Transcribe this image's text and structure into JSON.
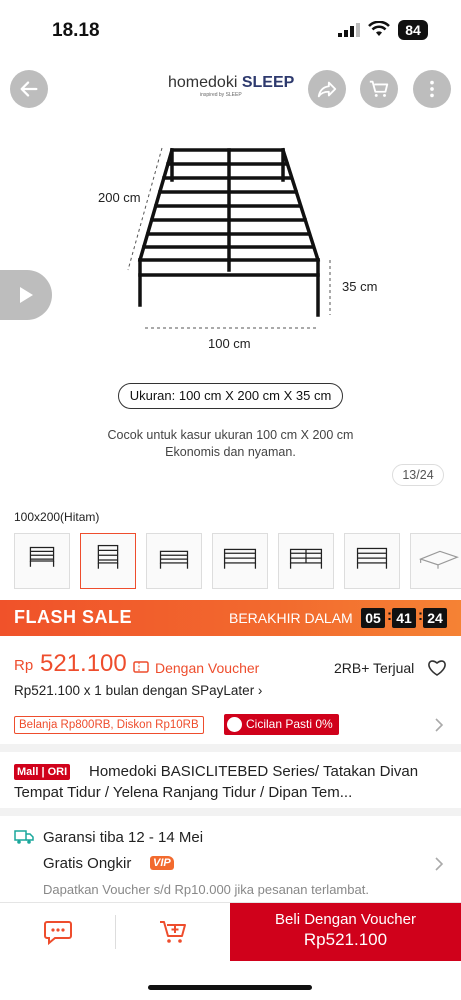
{
  "status_bar": {
    "time": "18.18",
    "battery": "84"
  },
  "header": {
    "brand_name": "homedoki",
    "brand_bold": "SLEEP",
    "brand_sub": "inspired by SLEEP"
  },
  "image": {
    "dim_length": "200 cm",
    "dim_height": "35 cm",
    "dim_width": "100 cm",
    "size_pill": "Ukuran: 100 cm X 200 cm X 35 cm",
    "caption_line1": "Cocok untuk kasur ukuran 100 cm X 200 cm",
    "caption_line2": "Ekonomis dan nyaman.",
    "counter": "13/24"
  },
  "variant": {
    "label": "100x200(Hitam)",
    "thumb_count": 7,
    "selected_index": 1
  },
  "flash_sale": {
    "title": "FLASH SALE",
    "ends_label": "BERAKHIR DALAM",
    "hours": "05",
    "minutes": "41",
    "seconds": "24"
  },
  "price": {
    "currency": "Rp",
    "value": "521.100",
    "voucher_text": "Dengan Voucher",
    "sold": "2RB+ Terjual",
    "spaylater": "Rp521.100 x 1 bulan dengan SPayLater ›"
  },
  "promos": {
    "discount": "Belanja Rp800RB, Diskon Rp10RB",
    "installment": "Cicilan Pasti 0%"
  },
  "product": {
    "mall_badge": "Mall | ORI",
    "title": "Homedoki BASICLITEBED  Series/ Tatakan Divan Tempat Tidur / Yelena Ranjang Tidur / Dipan Tem..."
  },
  "shipping": {
    "warranty": "Garansi tiba 12 - 14 Mei",
    "free_shipping": "Gratis Ongkir",
    "vip": "VIP",
    "voucher_note": "Dapatkan Voucher s/d Rp10.000 jika pesanan terlambat."
  },
  "bottom_bar": {
    "buy_line1": "Beli Dengan Voucher",
    "buy_line2": "Rp521.100"
  },
  "colors": {
    "accent": "#ee4d2d",
    "mall_red": "#d0011b",
    "flash_start": "#f0522a",
    "flash_end": "#f58234"
  }
}
